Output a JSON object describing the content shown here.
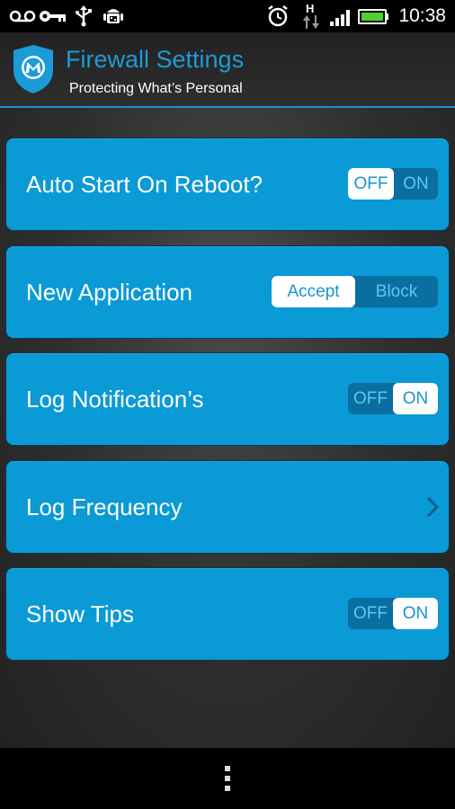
{
  "status_bar": {
    "time": "10:38",
    "network_label": "H",
    "icons": [
      "voicemail-icon",
      "key-icon",
      "usb-icon",
      "android-debug-icon",
      "alarm-icon",
      "data-transfer-icon",
      "signal-icon",
      "battery-icon"
    ],
    "battery_level": 1.0
  },
  "header": {
    "title": "Firewall Settings",
    "subtitle": "Protecting What’s Personal",
    "accent_color": "#1f9bd9"
  },
  "settings": [
    {
      "label": "Auto Start On Reboot?",
      "type": "toggle",
      "options": [
        "OFF",
        "ON"
      ],
      "selected": "OFF"
    },
    {
      "label": "New Application",
      "type": "toggle",
      "options": [
        "Accept",
        "Block"
      ],
      "selected": "Accept"
    },
    {
      "label": "Log Notification’s",
      "type": "toggle",
      "options": [
        "OFF",
        "ON"
      ],
      "selected": "ON"
    },
    {
      "label": "Log Frequency",
      "type": "link"
    },
    {
      "label": "Show Tips",
      "type": "toggle",
      "options": [
        "OFF",
        "ON"
      ],
      "selected": "ON"
    }
  ],
  "colors": {
    "row_background": "#0a9ad6",
    "toggle_track": "#0a6ea0",
    "toggle_selected": "#ffffff"
  }
}
